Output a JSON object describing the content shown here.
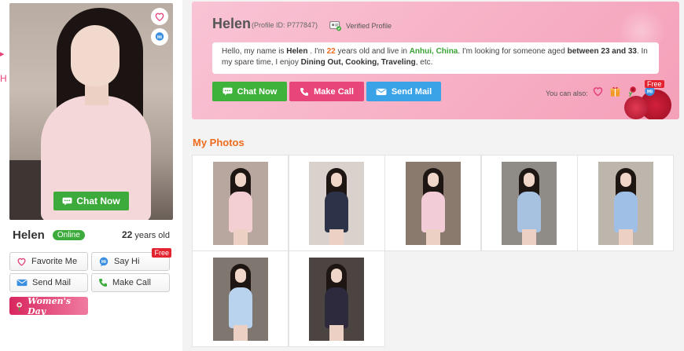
{
  "edge": {
    "arrow": "▸",
    "letter": "H"
  },
  "profile": {
    "name": "Helen",
    "status": "Online",
    "age_number": "22",
    "age_suffix": " years old",
    "photo_chat_label": "Chat Now"
  },
  "actions": {
    "favorite": "Favorite Me",
    "say_hi": "Say Hi",
    "say_hi_badge": "Free",
    "send_mail": "Send Mail",
    "make_call": "Make Call",
    "womens_day": "Women's Day"
  },
  "header": {
    "name": "Helen",
    "profile_id": "(Profile ID: P777847)",
    "verified": "Verified Profile",
    "intro": {
      "p1": "Hello, my name is ",
      "name": "Helen",
      "p2": " . I'm ",
      "age": "22",
      "p3": " years old and live in ",
      "location": "Anhui, China",
      "p4": ". I'm looking for someone aged ",
      "range": "between 23 and 33",
      "p5": ". In my spare time, I enjoy ",
      "hobbies": "Dining Out, Cooking, Traveling",
      "p6": ", etc."
    },
    "buttons": {
      "chat": "Chat Now",
      "call": "Make Call",
      "mail": "Send Mail"
    },
    "also_label": "You can also:",
    "also_icons": [
      "heart-icon",
      "gift-icon",
      "rose-icon",
      "hi-icon"
    ],
    "also_badge": "Free"
  },
  "photos": {
    "title": "My Photos",
    "items": [
      {
        "dress": "#f3cfd4",
        "bg": "#b8a79e"
      },
      {
        "dress": "#2c3248",
        "bg": "#d9d1cb"
      },
      {
        "dress": "#f2ccd6",
        "bg": "#8a7a6e"
      },
      {
        "dress": "#a7c1e0",
        "bg": "#8f8c88"
      },
      {
        "dress": "#9fbfe6",
        "bg": "#bdb6ac"
      },
      {
        "dress": "#b9d3ee",
        "bg": "#7f7670"
      },
      {
        "dress": "#2d2a3e",
        "bg": "#4b4440"
      }
    ]
  },
  "colors": {
    "accent": "#ef6b1d",
    "green": "#3cab3c",
    "pink": "#e8457a",
    "blue": "#3aa3e8"
  }
}
